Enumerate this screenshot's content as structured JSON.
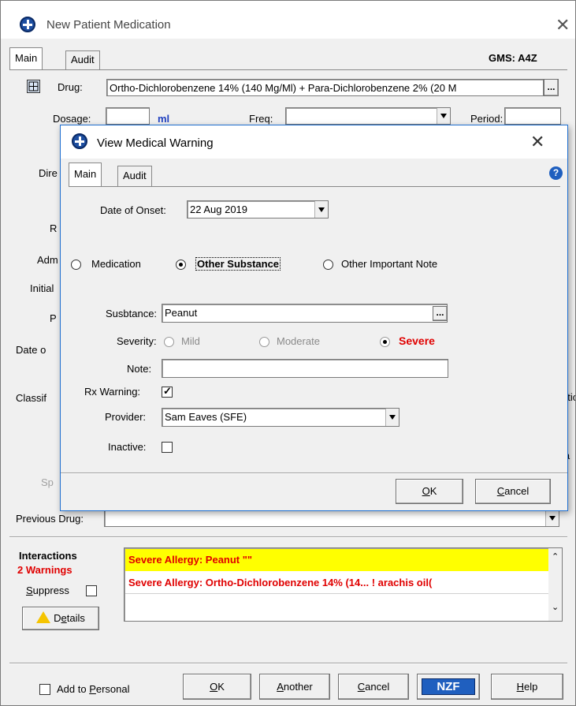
{
  "window": {
    "title": "New Patient Medication",
    "tabs": [
      "Main",
      "Audit"
    ],
    "gms": "GMS: A4Z"
  },
  "form": {
    "drug_label": "Drug:",
    "drug_value": "Ortho-Dichlorobenzene 14% (140 Mg/Ml) + Para-Dichlorobenzene 2% (20 M",
    "ellipsis": "...",
    "dosage_label": "Dosage:",
    "dosage_unit": "ml",
    "freq_label": "Freq:",
    "period_label": "Period:",
    "partial_labels": [
      "Dire",
      "R",
      "Adm",
      "Initial",
      "P",
      "Date o",
      "Classif",
      "Sp"
    ],
    "right_partials": [
      "utior",
      "ia"
    ],
    "previous_drug_label": "Previous Drug:"
  },
  "interactions": {
    "title": "Interactions",
    "warnings_count": "2 Warnings",
    "suppress_label": "Suppress",
    "details_label": "Details",
    "rows": [
      "Severe Allergy: Peanut \"\"",
      "Severe Allergy: Ortho-Dichlorobenzene 14% (14... ! arachis oil("
    ]
  },
  "footer": {
    "add_to_personal": "Add to Personal",
    "ok": "OK",
    "another": "Another",
    "cancel": "Cancel",
    "nzf": "NZF",
    "help": "Help"
  },
  "dialog": {
    "title": "View Medical Warning",
    "tabs": [
      "Main",
      "Audit"
    ],
    "help_icon": "?",
    "date_of_onset_label": "Date of Onset:",
    "date_of_onset_value": "22 Aug 2019",
    "type_options": [
      "Medication",
      "Other Substance",
      "Other Important Note"
    ],
    "type_selected": "Other Substance",
    "substance_label": "Susbtance:",
    "substance_value": "Peanut",
    "severity_label": "Severity:",
    "severity_options": [
      "Mild",
      "Moderate",
      "Severe"
    ],
    "severity_selected": "Severe",
    "note_label": "Note:",
    "note_value": "",
    "rx_warning_label": "Rx Warning:",
    "rx_warning_checked": true,
    "provider_label": "Provider:",
    "provider_value": "Sam Eaves (SFE)",
    "inactive_label": "Inactive:",
    "inactive_checked": false,
    "ok": "OK",
    "cancel": "Cancel"
  },
  "colors": {
    "warning_red": "#e00000",
    "highlight_yellow": "#ffff00",
    "accent_blue": "#1f5fbf"
  }
}
